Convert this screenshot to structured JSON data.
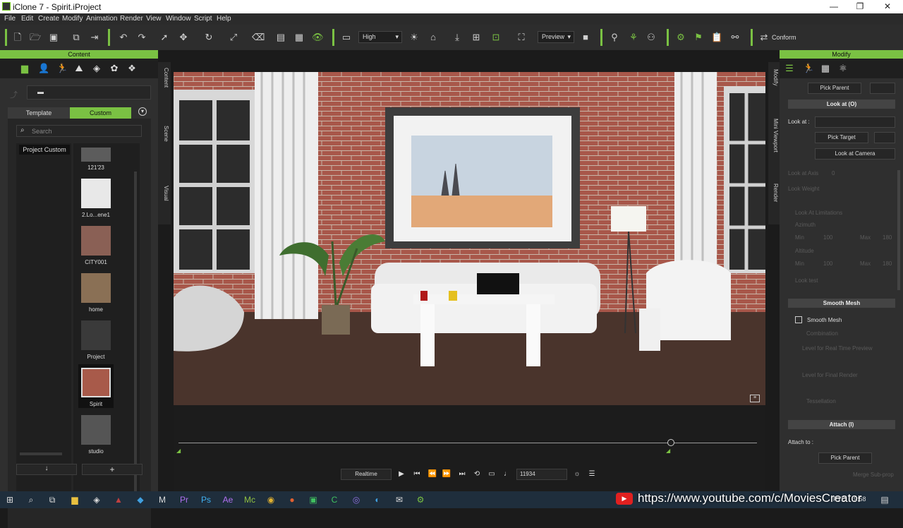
{
  "window": {
    "title": "iClone 7 - Spirit.iProject",
    "minimize": "—",
    "maximize": "❐",
    "close": "✕"
  },
  "menu": [
    "File",
    "Edit",
    "Create",
    "Modify",
    "Animation",
    "Render",
    "View",
    "Window",
    "Script",
    "Help"
  ],
  "toolbar": {
    "quality": "High",
    "preview": "Preview",
    "conform": "Conform"
  },
  "content": {
    "header": "Content",
    "tab_template": "Template",
    "tab_custom": "Custom",
    "search_placeholder": "Search",
    "folder": "Project Custom",
    "items": [
      {
        "label": "121'23",
        "color": "#5c5c5c"
      },
      {
        "label": "2.Lo...ene1",
        "color": "#e8e8e8"
      },
      {
        "label": "CITY001",
        "color": "#8a6055"
      },
      {
        "label": "home",
        "color": "#8a7055"
      },
      {
        "label": "Project",
        "color": "#3a3a3a"
      },
      {
        "label": "Spirit",
        "color": "#a85a4a"
      },
      {
        "label": "studio",
        "color": "#555555"
      }
    ]
  },
  "side_tabs": {
    "left": [
      "Content",
      "Scene",
      "Visual"
    ],
    "right": [
      "Modify",
      "Mini Viewport",
      "Render"
    ]
  },
  "modify": {
    "header": "Modify",
    "pick_parent": "Pick Parent",
    "look_at_section": "Look at  (O)",
    "look_at_label": "Look at :",
    "pick_target": "Pick Target",
    "look_at_camera": "Look at Camera",
    "look_at_axis": "Look at Axis",
    "look_weight": "Look Weight",
    "look_at_limitations": "Look At Limitations",
    "azimuth": "Azimuth",
    "altitude": "Altitude",
    "min": "Min",
    "max": "Max",
    "min_val": "100",
    "max_val": "180",
    "look_axis_val": "0",
    "look_test": "Look test",
    "smooth_mesh_section": "Smooth Mesh",
    "smooth_mesh": "Smooth Mesh",
    "combination": "Combination",
    "level_realtime": "Level for Real Time Preview",
    "level_final": "Level for Final Render",
    "tessellation": "Tessellation",
    "attach_section": "Attach  (I)",
    "attach_to": "Attach to :",
    "pick_parent2": "Pick Parent",
    "merge": "Merge Sub-prop"
  },
  "playback": {
    "mode": "Realtime",
    "frame": "11934"
  },
  "taskbar": {
    "url": "https://www.youtube.com/c/MoviesCreator",
    "time": "9:58",
    "lang": "РУС"
  },
  "colors": {
    "accent": "#7ac143",
    "brick": "#a8574a",
    "floor": "#4a342c"
  }
}
